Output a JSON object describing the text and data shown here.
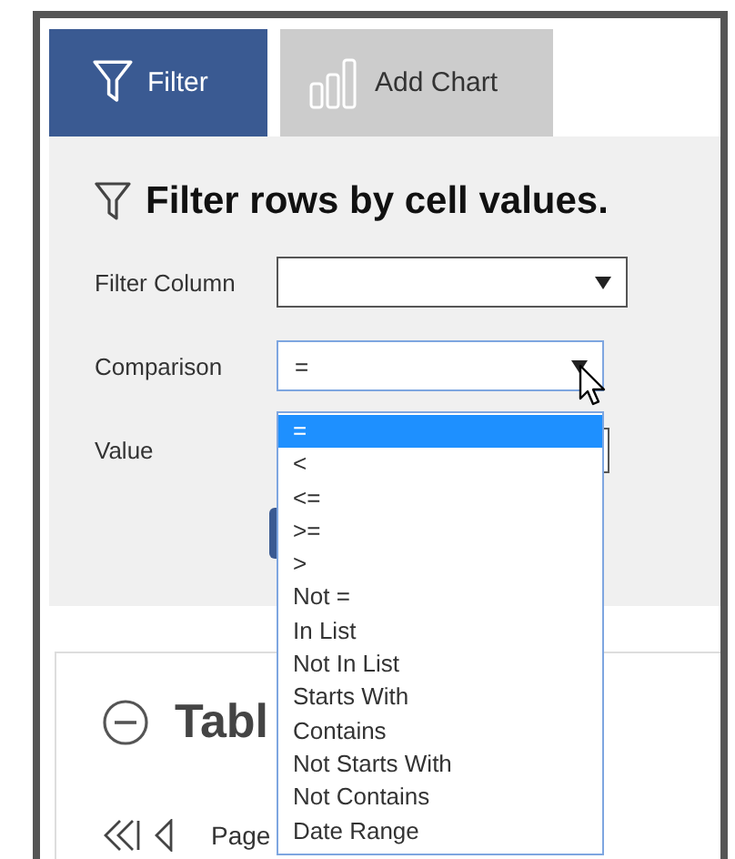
{
  "tabs": [
    {
      "label": "Filter",
      "kind": "filter",
      "selected": true
    },
    {
      "label": "Add Chart",
      "kind": "chart",
      "selected": false
    }
  ],
  "filter_panel": {
    "heading": "Filter rows by cell values.",
    "fields": [
      {
        "kind": "select",
        "label": "Filter Column",
        "focused": false
      },
      {
        "kind": "select",
        "label": "Comparison",
        "value": "=",
        "focused": true
      },
      {
        "kind": "input",
        "label": "Value",
        "focused": false
      }
    ],
    "dropdown": {
      "options": [
        {
          "label": "=",
          "selected": true
        },
        {
          "label": "<",
          "selected": false
        },
        {
          "label": "<=",
          "selected": false
        },
        {
          "label": ">=",
          "selected": false
        },
        {
          "label": ">",
          "selected": false
        },
        {
          "label": "Not =",
          "selected": false
        },
        {
          "label": "In List",
          "selected": false
        },
        {
          "label": "Not In List",
          "selected": false
        },
        {
          "label": "Starts With",
          "selected": false
        },
        {
          "label": "Contains",
          "selected": false
        },
        {
          "label": "Not Starts With",
          "selected": false
        },
        {
          "label": "Not Contains",
          "selected": false
        },
        {
          "label": "Date Range",
          "selected": false
        }
      ]
    }
  },
  "table_section": {
    "heading": "Tabl",
    "pager_label": "Page"
  }
}
